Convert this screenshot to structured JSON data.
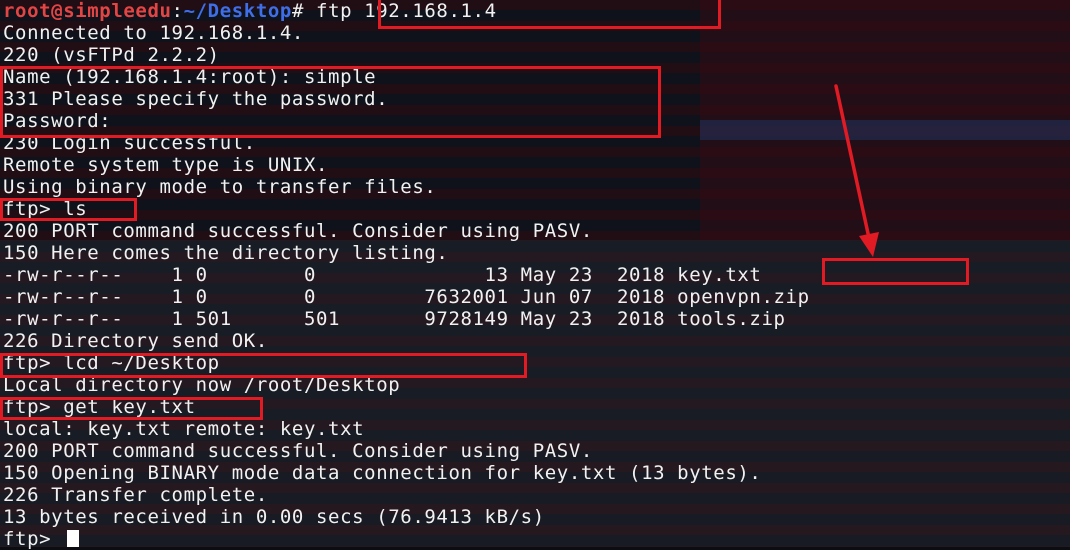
{
  "prompt": {
    "user_host": "root@simpleedu",
    "separator": ":",
    "path": "~/Desktop",
    "symbol": "#",
    "command": " ftp 192.168.1.4"
  },
  "output_lines": [
    "Connected to 192.168.1.4.",
    "220 (vsFTPd 2.2.2)",
    "Name (192.168.1.4:root): simple",
    "331 Please specify the password.",
    "Password:",
    "230 Login successful.",
    "Remote system type is UNIX.",
    "Using binary mode to transfer files.",
    "ftp> ls",
    "200 PORT command successful. Consider using PASV.",
    "150 Here comes the directory listing.",
    "-rw-r--r--    1 0        0              13 May 23  2018 key.txt",
    "-rw-r--r--    1 0        0         7632001 Jun 07  2018 openvpn.zip",
    "-rw-r--r--    1 501      501       9728149 May 23  2018 tools.zip",
    "226 Directory send OK.",
    "ftp> lcd ~/Desktop",
    "Local directory now /root/Desktop",
    "ftp> get key.txt",
    "local: key.txt remote: key.txt",
    "200 PORT command successful. Consider using PASV.",
    "150 Opening BINARY mode data connection for key.txt (13 bytes).",
    "226 Transfer complete.",
    "13 bytes received in 0.00 secs (76.9413 kB/s)",
    "ftp> "
  ],
  "colors": {
    "user_host": "#e34545",
    "path": "#3f6fe8",
    "text": "#f1f1f1",
    "highlight": "#e01b24"
  },
  "icons": {
    "cursor": "block-cursor",
    "annotation": "red-arrow"
  }
}
